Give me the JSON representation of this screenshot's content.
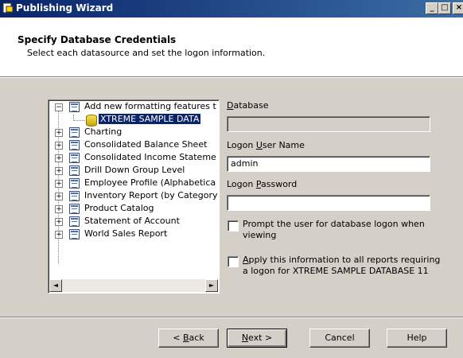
{
  "window": {
    "title": "Publishing Wizard",
    "controls": {
      "minimize": "_",
      "maximize": "□",
      "close": "×"
    }
  },
  "header": {
    "title": "Specify Database Credentials",
    "subtitle": "Select each datasource and set the logon information."
  },
  "tree": {
    "items": [
      {
        "label": "Add new formatting features t",
        "expander": "−",
        "icon": "report-icon"
      },
      {
        "label": "XTREME SAMPLE DATA",
        "icon": "database-icon",
        "selected": true
      },
      {
        "label": "Charting",
        "expander": "+",
        "icon": "report-icon"
      },
      {
        "label": "Consolidated Balance Sheet",
        "expander": "+",
        "icon": "report-icon"
      },
      {
        "label": "Consolidated Income Stateme",
        "expander": "+",
        "icon": "report-icon"
      },
      {
        "label": "Drill Down Group Level",
        "expander": "+",
        "icon": "report-icon"
      },
      {
        "label": "Employee Profile (Alphabetica",
        "expander": "+",
        "icon": "report-icon"
      },
      {
        "label": "Inventory Report (by Category",
        "expander": "+",
        "icon": "report-icon"
      },
      {
        "label": "Product Catalog",
        "expander": "+",
        "icon": "report-icon"
      },
      {
        "label": "Statement of Account",
        "expander": "+",
        "icon": "report-icon"
      },
      {
        "label": "World Sales Report",
        "expander": "+",
        "icon": "report-icon"
      }
    ],
    "scroll_left": "◄",
    "scroll_right": "►"
  },
  "form": {
    "database_label_pre": "",
    "database_label_key": "D",
    "database_label_post": "atabase",
    "database_value": "",
    "user_label_pre": "Logon ",
    "user_label_key": "U",
    "user_label_post": "ser Name",
    "user_value": "admin",
    "password_label_pre": "Logon ",
    "password_label_key": "P",
    "password_label_post": "assword",
    "password_value": "",
    "prompt_label": "Prompt the user for database logon when viewing",
    "apply_label_key": "A",
    "apply_label_post": "pply this information to all reports requiring a logon for XTREME SAMPLE DATABASE 11"
  },
  "buttons": {
    "back_pre": "< ",
    "back_key": "B",
    "back_post": "ack",
    "next_key": "N",
    "next_post": "ext >",
    "cancel": "Cancel",
    "help": "Help"
  }
}
